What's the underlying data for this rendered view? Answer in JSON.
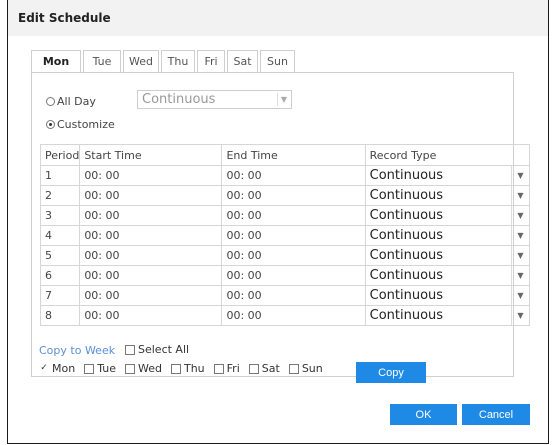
{
  "dialog": {
    "title": "Edit Schedule"
  },
  "tabs": [
    "Mon",
    "Tue",
    "Wed",
    "Thu",
    "Fri",
    "Sat",
    "Sun"
  ],
  "active_tab": "Mon",
  "mode": {
    "all_day_label": "All Day",
    "all_day_value": "Continuous",
    "customize_label": "Customize",
    "selected": "Customize"
  },
  "table": {
    "headers": [
      "Period",
      "Start Time",
      "End Time",
      "Record Type"
    ],
    "rows": [
      {
        "period": "1",
        "start": "00: 00",
        "end": "00: 00",
        "type": "Continuous"
      },
      {
        "period": "2",
        "start": "00: 00",
        "end": "00: 00",
        "type": "Continuous"
      },
      {
        "period": "3",
        "start": "00: 00",
        "end": "00: 00",
        "type": "Continuous"
      },
      {
        "period": "4",
        "start": "00: 00",
        "end": "00: 00",
        "type": "Continuous"
      },
      {
        "period": "5",
        "start": "00: 00",
        "end": "00: 00",
        "type": "Continuous"
      },
      {
        "period": "6",
        "start": "00: 00",
        "end": "00: 00",
        "type": "Continuous"
      },
      {
        "period": "7",
        "start": "00: 00",
        "end": "00: 00",
        "type": "Continuous"
      },
      {
        "period": "8",
        "start": "00: 00",
        "end": "00: 00",
        "type": "Continuous"
      }
    ]
  },
  "copy": {
    "link_label": "Copy to Week",
    "select_all_label": "Select All",
    "days": [
      {
        "label": "Mon",
        "checked": true
      },
      {
        "label": "Tue",
        "checked": false
      },
      {
        "label": "Wed",
        "checked": false
      },
      {
        "label": "Thu",
        "checked": false
      },
      {
        "label": "Fri",
        "checked": false
      },
      {
        "label": "Sat",
        "checked": false
      },
      {
        "label": "Sun",
        "checked": false
      }
    ],
    "button_label": "Copy"
  },
  "footer": {
    "ok_label": "OK",
    "cancel_label": "Cancel"
  },
  "colors": {
    "accent": "#1f8ae6",
    "link": "#5b8fd6",
    "title_bg": "#f2f2f2"
  },
  "icons": {
    "dropdown": "chevron-down-icon",
    "checkmark": "check-icon"
  }
}
